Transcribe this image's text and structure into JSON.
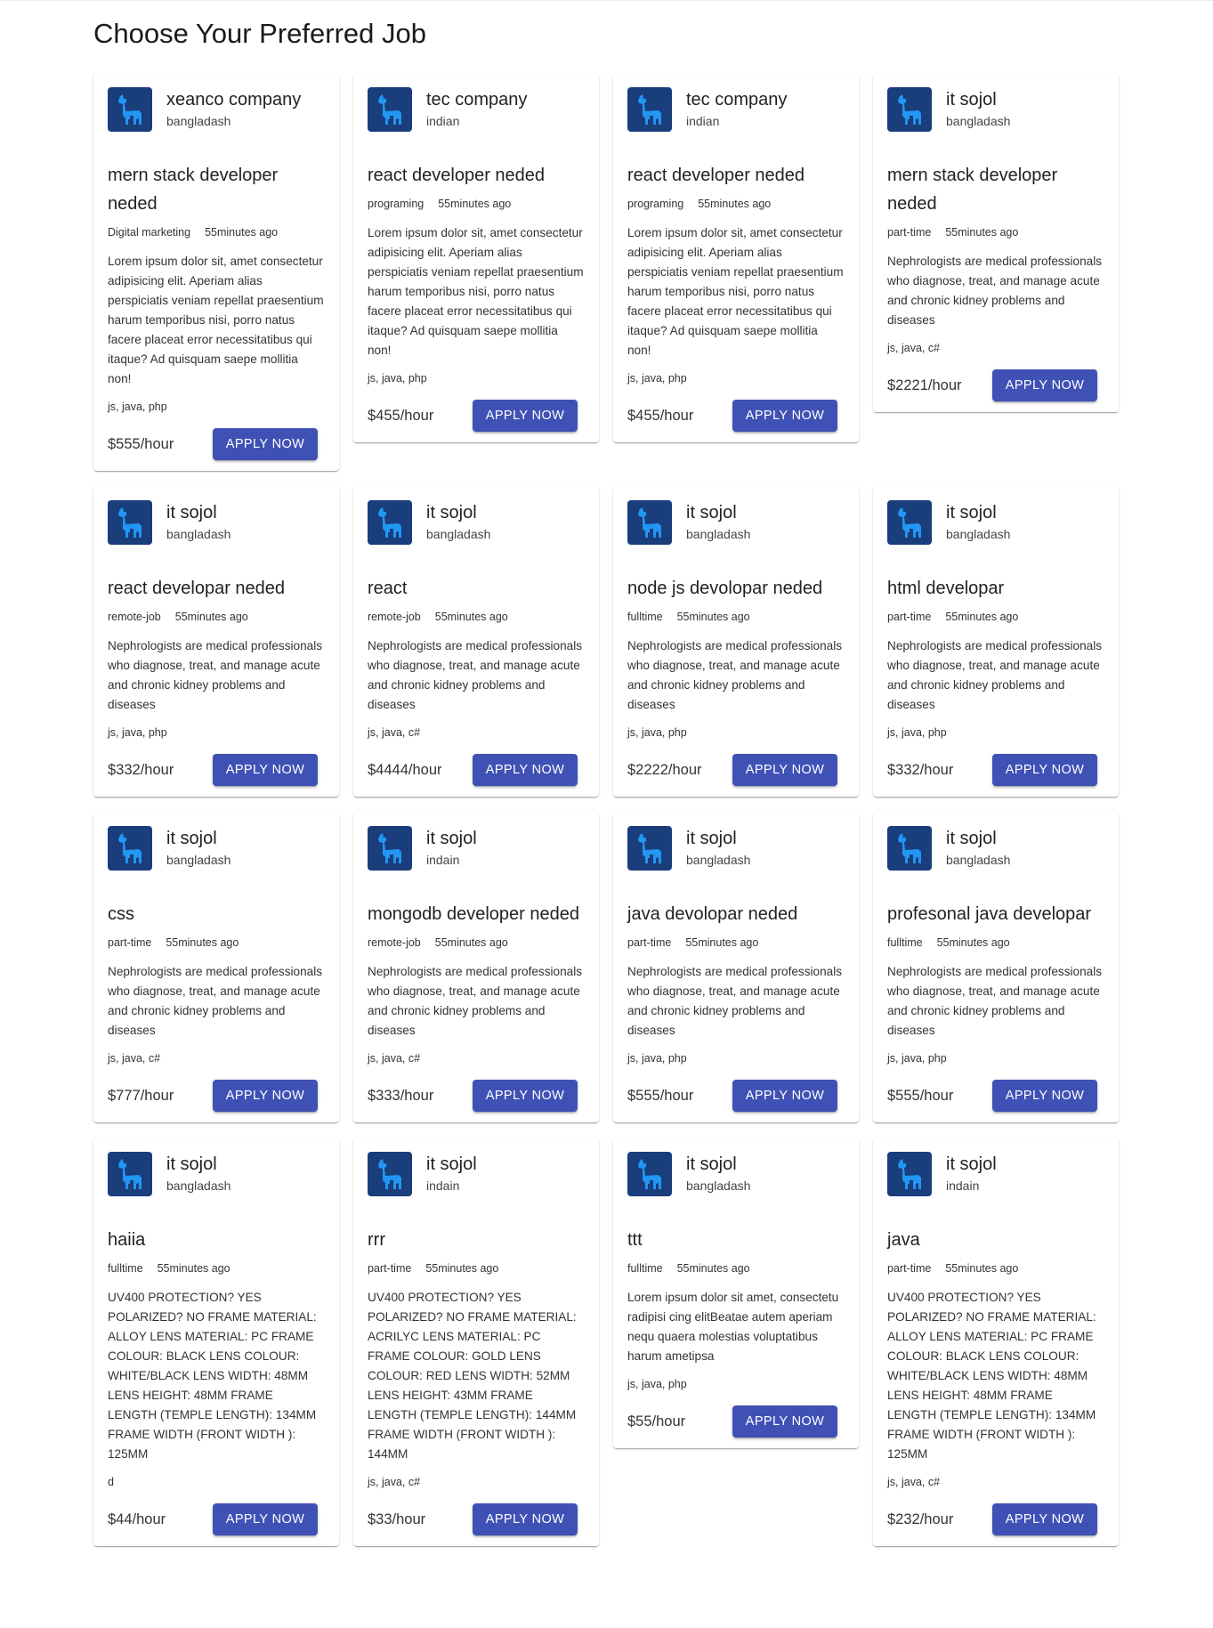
{
  "page": {
    "title": "Choose Your Preferred Job"
  },
  "colors": {
    "accent": "#3f51b5",
    "logo_bg": "#1a3d7c",
    "logo_fg": "#2196f3"
  },
  "apply_label": "APPLY NOW",
  "jobs": [
    {
      "company": "xeanco company",
      "location": "bangladash",
      "title": "mern stack developer neded",
      "category": "Digital marketing",
      "posted": "55minutes ago",
      "description": "Lorem ipsum dolor sit, amet consectetur adipisicing elit. Aperiam alias perspiciatis veniam repellat praesentium harum temporibus nisi, porro natus facere placeat error necessitatibus qui itaque? Ad quisquam saepe mollitia non!",
      "skills": "js, java, php",
      "price": "$555/hour"
    },
    {
      "company": "tec company",
      "location": "indian",
      "title": "react developer neded",
      "category": "programing",
      "posted": "55minutes ago",
      "description": "Lorem ipsum dolor sit, amet consectetur adipisicing elit. Aperiam alias perspiciatis veniam repellat praesentium harum temporibus nisi, porro natus facere placeat error necessitatibus qui itaque? Ad quisquam saepe mollitia non!",
      "skills": "js, java, php",
      "price": "$455/hour"
    },
    {
      "company": "tec company",
      "location": "indian",
      "title": "react developer neded",
      "category": "programing",
      "posted": "55minutes ago",
      "description": "Lorem ipsum dolor sit, amet consectetur adipisicing elit. Aperiam alias perspiciatis veniam repellat praesentium harum temporibus nisi, porro natus facere placeat error necessitatibus qui itaque? Ad quisquam saepe mollitia non!",
      "skills": "js, java, php",
      "price": "$455/hour"
    },
    {
      "company": "it sojol",
      "location": "bangladash",
      "title": "mern stack developer neded",
      "category": "part-time",
      "posted": "55minutes ago",
      "description": "Nephrologists are medical professionals who diagnose, treat, and manage acute and chronic kidney problems and diseases",
      "skills": "js, java, c#",
      "price": "$2221/hour"
    },
    {
      "company": "it sojol",
      "location": "bangladash",
      "title": "react developar neded",
      "category": "remote-job",
      "posted": "55minutes ago",
      "description": "Nephrologists are medical professionals who diagnose, treat, and manage acute and chronic kidney problems and diseases",
      "skills": "js, java, php",
      "price": "$332/hour"
    },
    {
      "company": "it sojol",
      "location": "bangladash",
      "title": "react",
      "category": "remote-job",
      "posted": "55minutes ago",
      "description": "Nephrologists are medical professionals who diagnose, treat, and manage acute and chronic kidney problems and diseases",
      "skills": "js, java, c#",
      "price": "$4444/hour"
    },
    {
      "company": "it sojol",
      "location": "bangladash",
      "title": "node js devolopar neded",
      "category": "fulltime",
      "posted": "55minutes ago",
      "description": "Nephrologists are medical professionals who diagnose, treat, and manage acute and chronic kidney problems and diseases",
      "skills": "js, java, php",
      "price": "$2222/hour"
    },
    {
      "company": "it sojol",
      "location": "bangladash",
      "title": "html developar",
      "category": "part-time",
      "posted": "55minutes ago",
      "description": "Nephrologists are medical professionals who diagnose, treat, and manage acute and chronic kidney problems and diseases",
      "skills": "js, java, php",
      "price": "$332/hour"
    },
    {
      "company": "it sojol",
      "location": "bangladash",
      "title": "css",
      "category": "part-time",
      "posted": "55minutes ago",
      "description": "Nephrologists are medical professionals who diagnose, treat, and manage acute and chronic kidney problems and diseases",
      "skills": "js, java, c#",
      "price": "$777/hour"
    },
    {
      "company": "it sojol",
      "location": "indain",
      "title": "mongodb developer neded",
      "category": "remote-job",
      "posted": "55minutes ago",
      "description": "Nephrologists are medical professionals who diagnose, treat, and manage acute and chronic kidney problems and diseases",
      "skills": "js, java, c#",
      "price": "$333/hour"
    },
    {
      "company": "it sojol",
      "location": "bangladash",
      "title": "java devolopar neded",
      "category": "part-time",
      "posted": "55minutes ago",
      "description": "Nephrologists are medical professionals who diagnose, treat, and manage acute and chronic kidney problems and diseases",
      "skills": "js, java, php",
      "price": "$555/hour"
    },
    {
      "company": "it sojol",
      "location": "bangladash",
      "title": "profesonal java developar",
      "category": "fulltime",
      "posted": "55minutes ago",
      "description": "Nephrologists are medical professionals who diagnose, treat, and manage acute and chronic kidney problems and diseases",
      "skills": "js, java, php",
      "price": "$555/hour"
    },
    {
      "company": "it sojol",
      "location": "bangladash",
      "title": "haiia",
      "category": "fulltime",
      "posted": "55minutes ago",
      "description": "UV400 PROTECTION? YES POLARIZED? NO FRAME MATERIAL: ALLOY LENS MATERIAL: PC FRAME COLOUR: BLACK LENS COLOUR: WHITE/BLACK LENS WIDTH: 48MM LENS HEIGHT: 48MM FRAME LENGTH (TEMPLE LENGTH): 134MM FRAME WIDTH (FRONT WIDTH ): 125MM",
      "skills": "d",
      "price": "$44/hour"
    },
    {
      "company": "it sojol",
      "location": "indain",
      "title": "rrr",
      "category": "part-time",
      "posted": "55minutes ago",
      "description": "UV400 PROTECTION? YES POLARIZED? NO FRAME MATERIAL: ACRILYC LENS MATERIAL: PC FRAME COLOUR: GOLD LENS COLOUR: RED LENS WIDTH: 52MM LENS HEIGHT: 43MM FRAME LENGTH (TEMPLE LENGTH): 144MM FRAME WIDTH (FRONT WIDTH ): 144MM",
      "skills": "js, java, c#",
      "price": "$33/hour"
    },
    {
      "company": "it sojol",
      "location": "bangladash",
      "title": "ttt",
      "category": "fulltime",
      "posted": "55minutes ago",
      "description": "Lorem ipsum dolor sit amet, consectetu radipisi cing elitBeatae autem aperiam nequ quaera molestias voluptatibus harum ametipsa",
      "skills": "js, java, php",
      "price": "$55/hour"
    },
    {
      "company": "it sojol",
      "location": "indain",
      "title": "java",
      "category": "part-time",
      "posted": "55minutes ago",
      "description": "UV400 PROTECTION? YES POLARIZED? NO FRAME MATERIAL: ALLOY LENS MATERIAL: PC FRAME COLOUR: BLACK LENS COLOUR: WHITE/BLACK LENS WIDTH: 48MM LENS HEIGHT: 48MM FRAME LENGTH (TEMPLE LENGTH): 134MM FRAME WIDTH (FRONT WIDTH ): 125MM",
      "skills": "js, java, c#",
      "price": "$232/hour"
    }
  ]
}
